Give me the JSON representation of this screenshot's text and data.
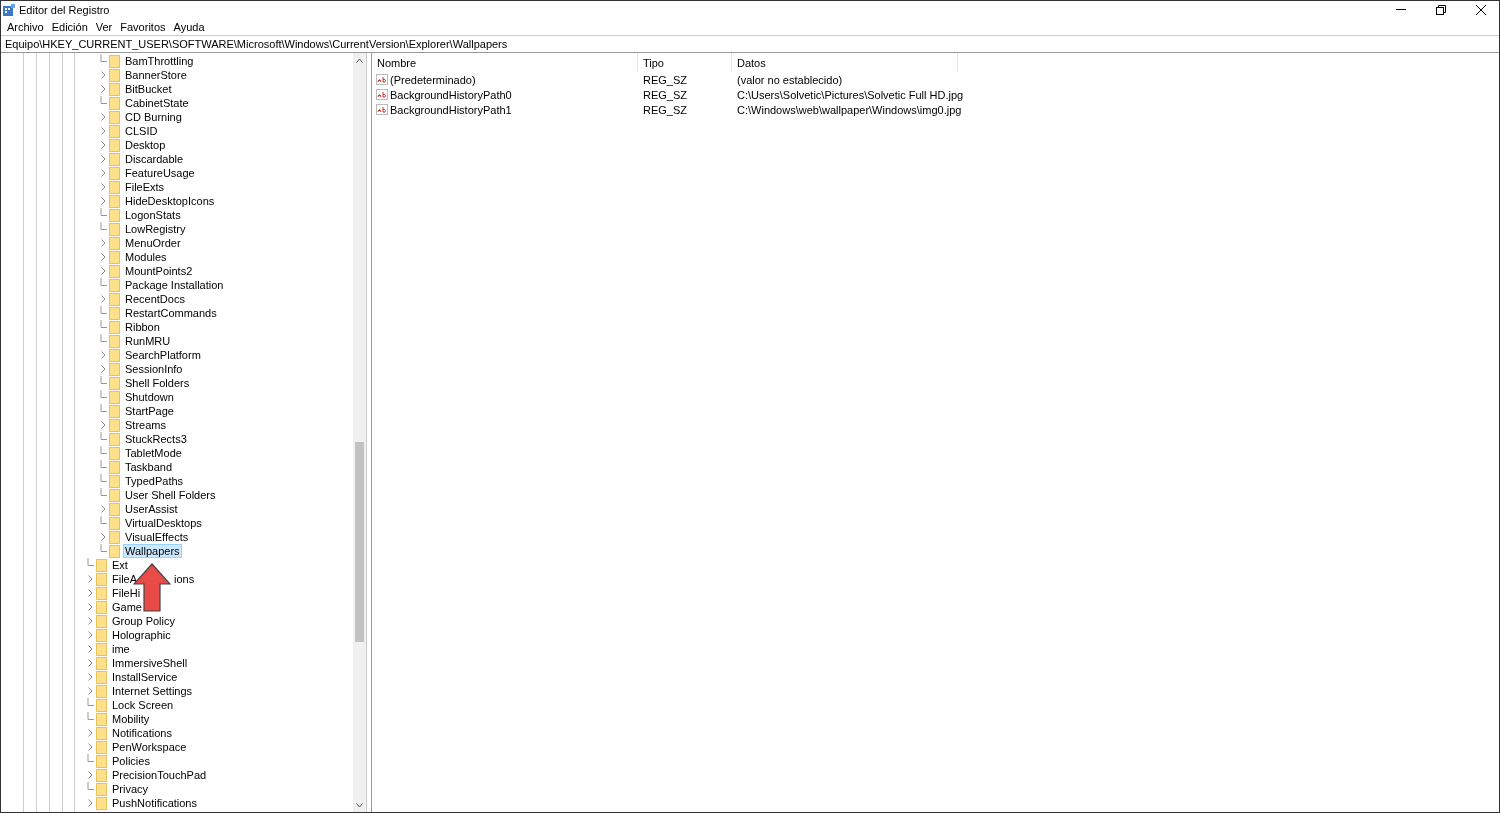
{
  "window": {
    "title": "Editor del Registro"
  },
  "menu": [
    "Archivo",
    "Edición",
    "Ver",
    "Favoritos",
    "Ayuda"
  ],
  "address": "Equipo\\HKEY_CURRENT_USER\\SOFTWARE\\Microsoft\\Windows\\CurrentVersion\\Explorer\\Wallpapers",
  "tree": {
    "nested_keys": [
      {
        "label": "BamThrottling",
        "expandable": false,
        "selected": false
      },
      {
        "label": "BannerStore",
        "expandable": true,
        "selected": false
      },
      {
        "label": "BitBucket",
        "expandable": true,
        "selected": false
      },
      {
        "label": "CabinetState",
        "expandable": false,
        "selected": false
      },
      {
        "label": "CD Burning",
        "expandable": true,
        "selected": false
      },
      {
        "label": "CLSID",
        "expandable": true,
        "selected": false
      },
      {
        "label": "Desktop",
        "expandable": true,
        "selected": false
      },
      {
        "label": "Discardable",
        "expandable": true,
        "selected": false
      },
      {
        "label": "FeatureUsage",
        "expandable": true,
        "selected": false
      },
      {
        "label": "FileExts",
        "expandable": true,
        "selected": false
      },
      {
        "label": "HideDesktopIcons",
        "expandable": true,
        "selected": false
      },
      {
        "label": "LogonStats",
        "expandable": false,
        "selected": false
      },
      {
        "label": "LowRegistry",
        "expandable": false,
        "selected": false
      },
      {
        "label": "MenuOrder",
        "expandable": true,
        "selected": false
      },
      {
        "label": "Modules",
        "expandable": true,
        "selected": false
      },
      {
        "label": "MountPoints2",
        "expandable": true,
        "selected": false
      },
      {
        "label": "Package Installation",
        "expandable": false,
        "selected": false
      },
      {
        "label": "RecentDocs",
        "expandable": true,
        "selected": false
      },
      {
        "label": "RestartCommands",
        "expandable": false,
        "selected": false
      },
      {
        "label": "Ribbon",
        "expandable": false,
        "selected": false
      },
      {
        "label": "RunMRU",
        "expandable": false,
        "selected": false
      },
      {
        "label": "SearchPlatform",
        "expandable": true,
        "selected": false
      },
      {
        "label": "SessionInfo",
        "expandable": true,
        "selected": false
      },
      {
        "label": "Shell Folders",
        "expandable": false,
        "selected": false
      },
      {
        "label": "Shutdown",
        "expandable": false,
        "selected": false
      },
      {
        "label": "StartPage",
        "expandable": false,
        "selected": false
      },
      {
        "label": "Streams",
        "expandable": true,
        "selected": false
      },
      {
        "label": "StuckRects3",
        "expandable": false,
        "selected": false
      },
      {
        "label": "TabletMode",
        "expandable": false,
        "selected": false
      },
      {
        "label": "Taskband",
        "expandable": false,
        "selected": false
      },
      {
        "label": "TypedPaths",
        "expandable": false,
        "selected": false
      },
      {
        "label": "User Shell Folders",
        "expandable": false,
        "selected": false
      },
      {
        "label": "UserAssist",
        "expandable": true,
        "selected": false
      },
      {
        "label": "VirtualDesktops",
        "expandable": false,
        "selected": false
      },
      {
        "label": "VisualEffects",
        "expandable": true,
        "selected": false
      },
      {
        "label": "Wallpapers",
        "expandable": false,
        "selected": true
      }
    ],
    "keys": [
      {
        "label": "Ext",
        "expandable": false,
        "selected": false
      },
      {
        "label": "FileA",
        "label_tail": "ions",
        "expandable": true,
        "selected": false
      },
      {
        "label": "FileHi",
        "expandable": true,
        "selected": false
      },
      {
        "label": "Game",
        "expandable": true,
        "selected": false
      },
      {
        "label": "Group Policy",
        "expandable": true,
        "selected": false
      },
      {
        "label": "Holographic",
        "expandable": true,
        "selected": false
      },
      {
        "label": "ime",
        "expandable": true,
        "selected": false
      },
      {
        "label": "ImmersiveShell",
        "expandable": true,
        "selected": false
      },
      {
        "label": "InstallService",
        "expandable": true,
        "selected": false
      },
      {
        "label": "Internet Settings",
        "expandable": true,
        "selected": false
      },
      {
        "label": "Lock Screen",
        "expandable": false,
        "selected": false
      },
      {
        "label": "Mobility",
        "expandable": false,
        "selected": false
      },
      {
        "label": "Notifications",
        "expandable": true,
        "selected": false
      },
      {
        "label": "PenWorkspace",
        "expandable": true,
        "selected": false
      },
      {
        "label": "Policies",
        "expandable": false,
        "selected": false
      },
      {
        "label": "PrecisionTouchPad",
        "expandable": true,
        "selected": false
      },
      {
        "label": "Privacy",
        "expandable": false,
        "selected": false
      },
      {
        "label": "PushNotifications",
        "expandable": true,
        "selected": false
      }
    ]
  },
  "table": {
    "columns": [
      "Nombre",
      "Tipo",
      "Datos"
    ],
    "rows": [
      {
        "name": "(Predeterminado)",
        "type": "REG_SZ",
        "data": "(valor no establecido)"
      },
      {
        "name": "BackgroundHistoryPath0",
        "type": "REG_SZ",
        "data": "C:\\Users\\Solvetic\\Pictures\\Solvetic Full HD.jpg"
      },
      {
        "name": "BackgroundHistoryPath1",
        "type": "REG_SZ",
        "data": "C:\\Windows\\web\\wallpaper\\Windows\\img0.jpg"
      }
    ]
  }
}
